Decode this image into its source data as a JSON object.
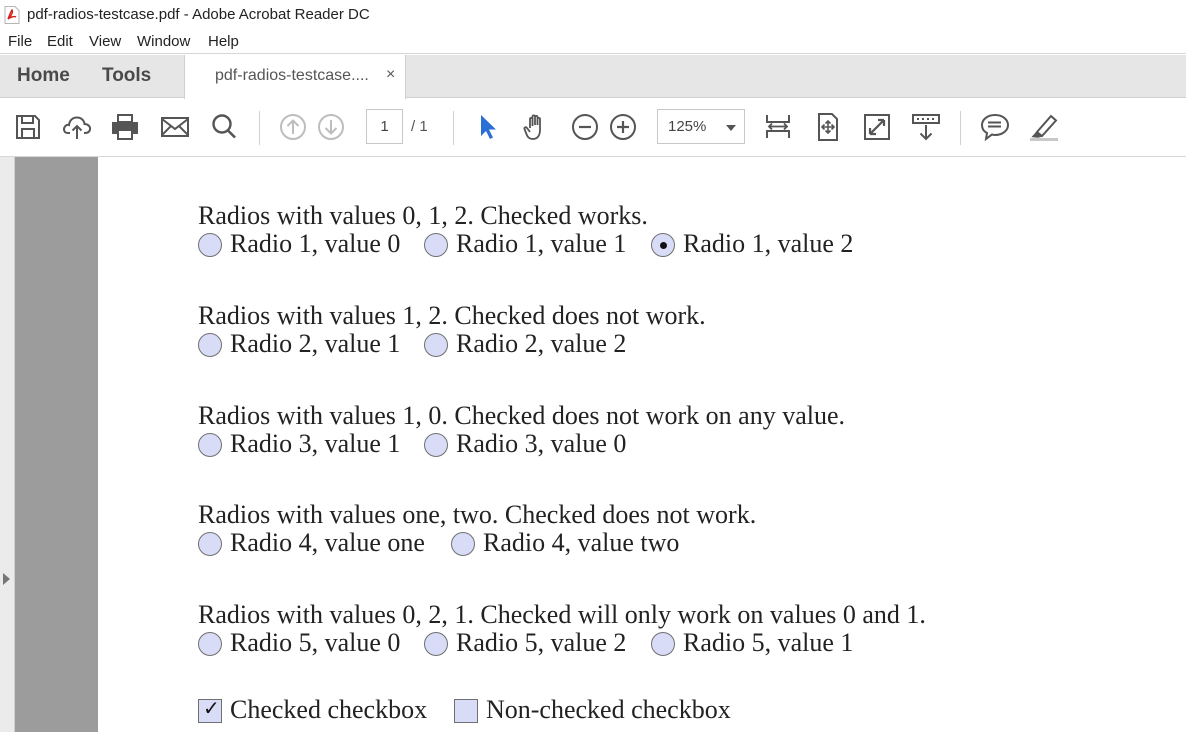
{
  "window": {
    "title": "pdf-radios-testcase.pdf - Adobe Acrobat Reader DC"
  },
  "menu": {
    "items": [
      "File",
      "Edit",
      "View",
      "Window",
      "Help"
    ]
  },
  "tabs": {
    "home": "Home",
    "tools": "Tools",
    "document": "pdf-radios-testcase....",
    "close_glyph": "×"
  },
  "toolbar": {
    "page_current": "1",
    "page_total": "/ 1",
    "zoom": "125%",
    "accent_color": "#2a6fd6"
  },
  "document": {
    "sections": [
      {
        "heading": "Radios with values 0, 1, 2. Checked works.",
        "radios": [
          {
            "label": "Radio 1, value 0",
            "checked": false
          },
          {
            "label": "Radio 1, value 1",
            "checked": false
          },
          {
            "label": "Radio 1, value 2",
            "checked": true
          }
        ]
      },
      {
        "heading": "Radios with values 1, 2. Checked does not work.",
        "radios": [
          {
            "label": "Radio 2, value 1",
            "checked": false
          },
          {
            "label": "Radio 2, value 2",
            "checked": false
          }
        ]
      },
      {
        "heading": "Radios with values 1, 0. Checked does not work on any value.",
        "radios": [
          {
            "label": "Radio 3, value 1",
            "checked": false
          },
          {
            "label": "Radio 3, value 0",
            "checked": false
          }
        ]
      },
      {
        "heading": "Radios with values one, two. Checked does not work.",
        "radios": [
          {
            "label": "Radio 4, value one",
            "checked": false
          },
          {
            "label": "Radio 4, value two",
            "checked": false
          }
        ]
      },
      {
        "heading": "Radios with values 0, 2, 1. Checked will only work on values 0 and 1.",
        "radios": [
          {
            "label": "Radio 5, value 0",
            "checked": false
          },
          {
            "label": "Radio 5, value 2",
            "checked": false
          },
          {
            "label": "Radio 5, value 1",
            "checked": false
          }
        ]
      }
    ],
    "checkboxes": [
      {
        "label": "Checked checkbox",
        "checked": true,
        "mark": "✓"
      },
      {
        "label": "Non-checked checkbox",
        "checked": false,
        "mark": ""
      }
    ]
  }
}
